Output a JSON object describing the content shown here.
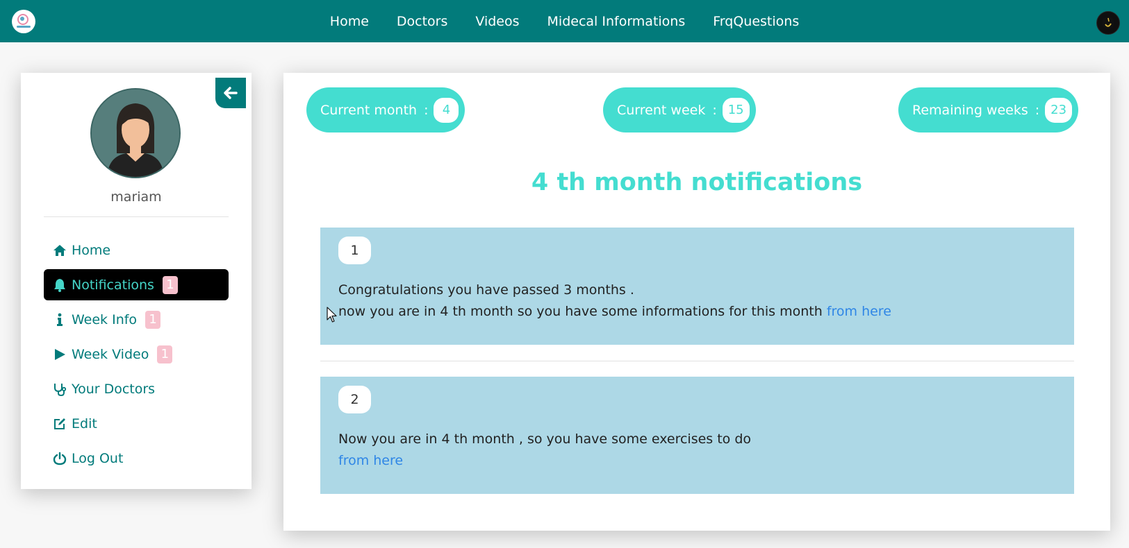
{
  "nav": {
    "links": [
      "Home",
      "Doctors",
      "Videos",
      "Midecal Informations",
      "FrqQuestions"
    ]
  },
  "profile": {
    "name": "mariam"
  },
  "sidebar": {
    "items": [
      {
        "label": "Home",
        "icon": "home-icon"
      },
      {
        "label": "Notifications",
        "icon": "bell-icon",
        "badge": "1",
        "active": true
      },
      {
        "label": "Week Info",
        "icon": "info-icon",
        "badge": "1"
      },
      {
        "label": "Week Video",
        "icon": "play-icon",
        "badge": "1"
      },
      {
        "label": "Your Doctors",
        "icon": "stethoscope-icon"
      },
      {
        "label": "Edit",
        "icon": "edit-icon"
      },
      {
        "label": "Log Out",
        "icon": "power-icon"
      }
    ]
  },
  "stats": {
    "current_month_label": "Current month",
    "current_month_value": "4",
    "current_week_label": "Current week",
    "current_week_value": "15",
    "remaining_weeks_label": "Remaining weeks",
    "remaining_weeks_value": "23",
    "separator": ":"
  },
  "section_title": "4 th month notifications",
  "notifications": [
    {
      "number": "1",
      "line1": "Congratulations you have passed 3 months .",
      "line2": "now you are in 4 th month so you have some informations for this month",
      "link": "from here"
    },
    {
      "number": "2",
      "line1": "Now you are in 4 th month , so you have some exercises to do",
      "link": "from here"
    }
  ],
  "colors": {
    "nav": "#027b7b",
    "accent": "#44ddd0",
    "notification_bg": "#add8e6",
    "badge": "#f7c1cd",
    "link": "#2f86e6"
  }
}
